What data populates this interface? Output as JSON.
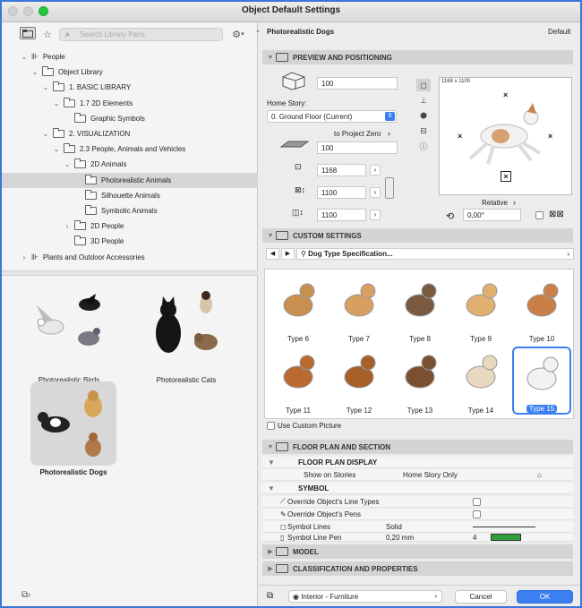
{
  "window": {
    "title": "Object Default Settings",
    "traffic_colors": [
      "#d9d9d9",
      "#d9d9d9",
      "#28c840"
    ]
  },
  "left": {
    "search_placeholder": "Search Library Parts",
    "tree": [
      {
        "label": "People",
        "chev": "⌄",
        "indent": 0,
        "icon": "library"
      },
      {
        "label": "Object Library",
        "chev": "⌄",
        "indent": 1,
        "icon": "folder"
      },
      {
        "label": "1. BASIC LIBRARY",
        "chev": "⌄",
        "indent": 2,
        "icon": "folder"
      },
      {
        "label": "1.7 2D Elements",
        "chev": "⌄",
        "indent": 3,
        "icon": "folder"
      },
      {
        "label": "Graphic Symbols",
        "chev": "",
        "indent": 4,
        "icon": "folder"
      },
      {
        "label": "2. VISUALIZATION",
        "chev": "⌄",
        "indent": 2,
        "icon": "folder"
      },
      {
        "label": "2.3 People, Animals and Vehicles",
        "chev": "⌄",
        "indent": 3,
        "icon": "folder"
      },
      {
        "label": "2D Animals",
        "chev": "⌄",
        "indent": 4,
        "icon": "folder"
      },
      {
        "label": "Photorealistic Animals",
        "chev": "",
        "indent": 5,
        "icon": "folder",
        "selected": true
      },
      {
        "label": "Silhouette Animals",
        "chev": "",
        "indent": 5,
        "icon": "folder"
      },
      {
        "label": "Symbolic Animals",
        "chev": "",
        "indent": 5,
        "icon": "folder"
      },
      {
        "label": "2D People",
        "chev": "›",
        "indent": 4,
        "icon": "folder"
      },
      {
        "label": "3D People",
        "chev": "",
        "indent": 4,
        "icon": "folder"
      },
      {
        "label": "Plants and Outdoor Accessories",
        "chev": "›",
        "indent": 0,
        "icon": "library"
      }
    ],
    "gallery": [
      {
        "label": "Photorealistic Birds"
      },
      {
        "label": "Photorealistic Cats"
      },
      {
        "label": "Photorealistic Dogs",
        "selected": true
      }
    ]
  },
  "right": {
    "object_name": "Photorealistic Dogs",
    "default_label": "Default",
    "sections": {
      "preview": "PREVIEW AND POSITIONING",
      "custom": "CUSTOM SETTINGS",
      "floorplan": "FLOOR PLAN AND SECTION",
      "model": "MODEL",
      "classification": "CLASSIFICATION AND PROPERTIES"
    },
    "positioning": {
      "elevation": "100",
      "home_story_label": "Home Story:",
      "home_story_value": "0. Ground Floor (Current)",
      "to_project_zero": "to Project Zero",
      "project_zero_value": "100",
      "width": "1168",
      "depth": "1100",
      "height": "1100",
      "relative_label": "Relative",
      "angle": "0,00°",
      "preview_size_tag": "1168 x 1100"
    },
    "custom": {
      "spec_label": "Dog Type Specification...",
      "types": [
        "Type 6",
        "Type 7",
        "Type 8",
        "Type 9",
        "Type 10",
        "Type 11",
        "Type 12",
        "Type 13",
        "Type 14",
        "Type 15"
      ],
      "selected_type": "Type 15",
      "use_custom_picture": "Use Custom Picture"
    },
    "floorplan": {
      "fp_display": "FLOOR PLAN DISPLAY",
      "show_on_stories": "Show on Stories",
      "show_on_stories_value": "Home Story Only",
      "symbol": "SYMBOL",
      "override_line_types": "Override Object's Line Types",
      "override_pens": "Override Object's Pens",
      "symbol_lines": "Symbol Lines",
      "symbol_lines_value": "Solid",
      "symbol_line_pen": "Symbol Line Pen",
      "symbol_line_pen_value": "0,20 mm",
      "symbol_line_pen_num": "4"
    },
    "footer": {
      "layer": "Interior - Furniture",
      "cancel": "Cancel",
      "ok": "OK"
    }
  }
}
